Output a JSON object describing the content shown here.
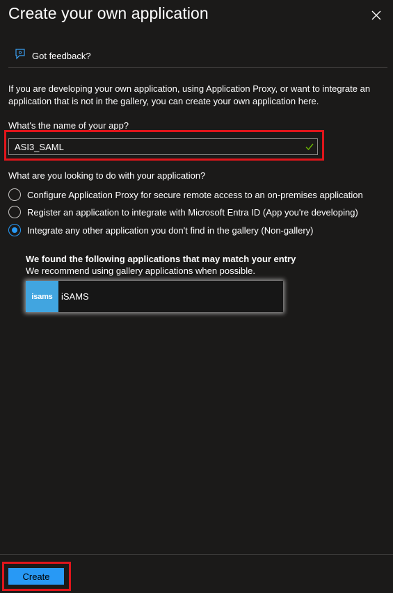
{
  "header": {
    "title": "Create your own application",
    "close_icon": "close-icon"
  },
  "feedback": {
    "label": "Got feedback?",
    "icon": "feedback-icon"
  },
  "intro_text": "If you are developing your own application, using Application Proxy, or want to integrate an application that is not in the gallery, you can create your own application here.",
  "name_field": {
    "label": "What's the name of your app?",
    "value": "ASI3_SAML",
    "valid_icon": "checkmark-icon"
  },
  "purpose": {
    "question": "What are you looking to do with your application?",
    "options": [
      {
        "label": "Configure Application Proxy for secure remote access to an on-premises application",
        "selected": false
      },
      {
        "label": "Register an application to integrate with Microsoft Entra ID (App you're developing)",
        "selected": false
      },
      {
        "label": "Integrate any other application you don't find in the gallery (Non-gallery)",
        "selected": true
      }
    ]
  },
  "suggestions": {
    "title": "We found the following applications that may match your entry",
    "subtitle": "We recommend using gallery applications when possible.",
    "apps": [
      {
        "logo_text": "isams",
        "name": "iSAMS"
      }
    ]
  },
  "footer": {
    "create_label": "Create"
  },
  "colors": {
    "accent": "#2899f5",
    "highlight": "#e0151b",
    "background": "#1b1a19",
    "check": "#6bb700"
  }
}
